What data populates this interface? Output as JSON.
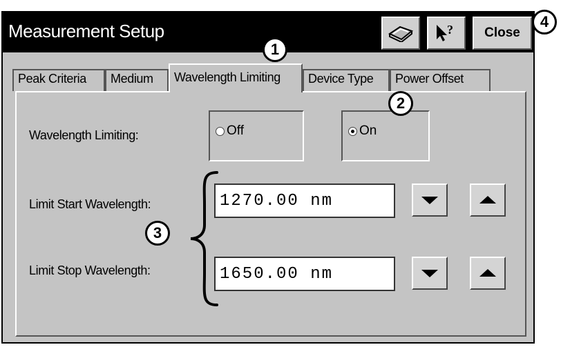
{
  "window": {
    "title": "Measurement Setup",
    "close_label": "Close",
    "help_icon": "book-help-icon",
    "whats_this_icon": "pointer-question-icon"
  },
  "tabs": [
    {
      "label": "Peak Criteria",
      "active": false
    },
    {
      "label": "Medium",
      "active": false
    },
    {
      "label": "Wavelength Limiting",
      "active": true
    },
    {
      "label": "Device Type",
      "active": false
    },
    {
      "label": "Power Offset",
      "active": false
    }
  ],
  "wavelength_limiting": {
    "label": "Wavelength Limiting:",
    "options": [
      {
        "label": "Off",
        "checked": false
      },
      {
        "label": "On",
        "checked": true
      }
    ]
  },
  "limit_start": {
    "label": "Limit Start Wavelength:",
    "value": "1270.00 nm"
  },
  "limit_stop": {
    "label": "Limit Stop Wavelength:",
    "value": "1650.00 nm"
  },
  "callouts": [
    "1",
    "2",
    "3",
    "4"
  ]
}
